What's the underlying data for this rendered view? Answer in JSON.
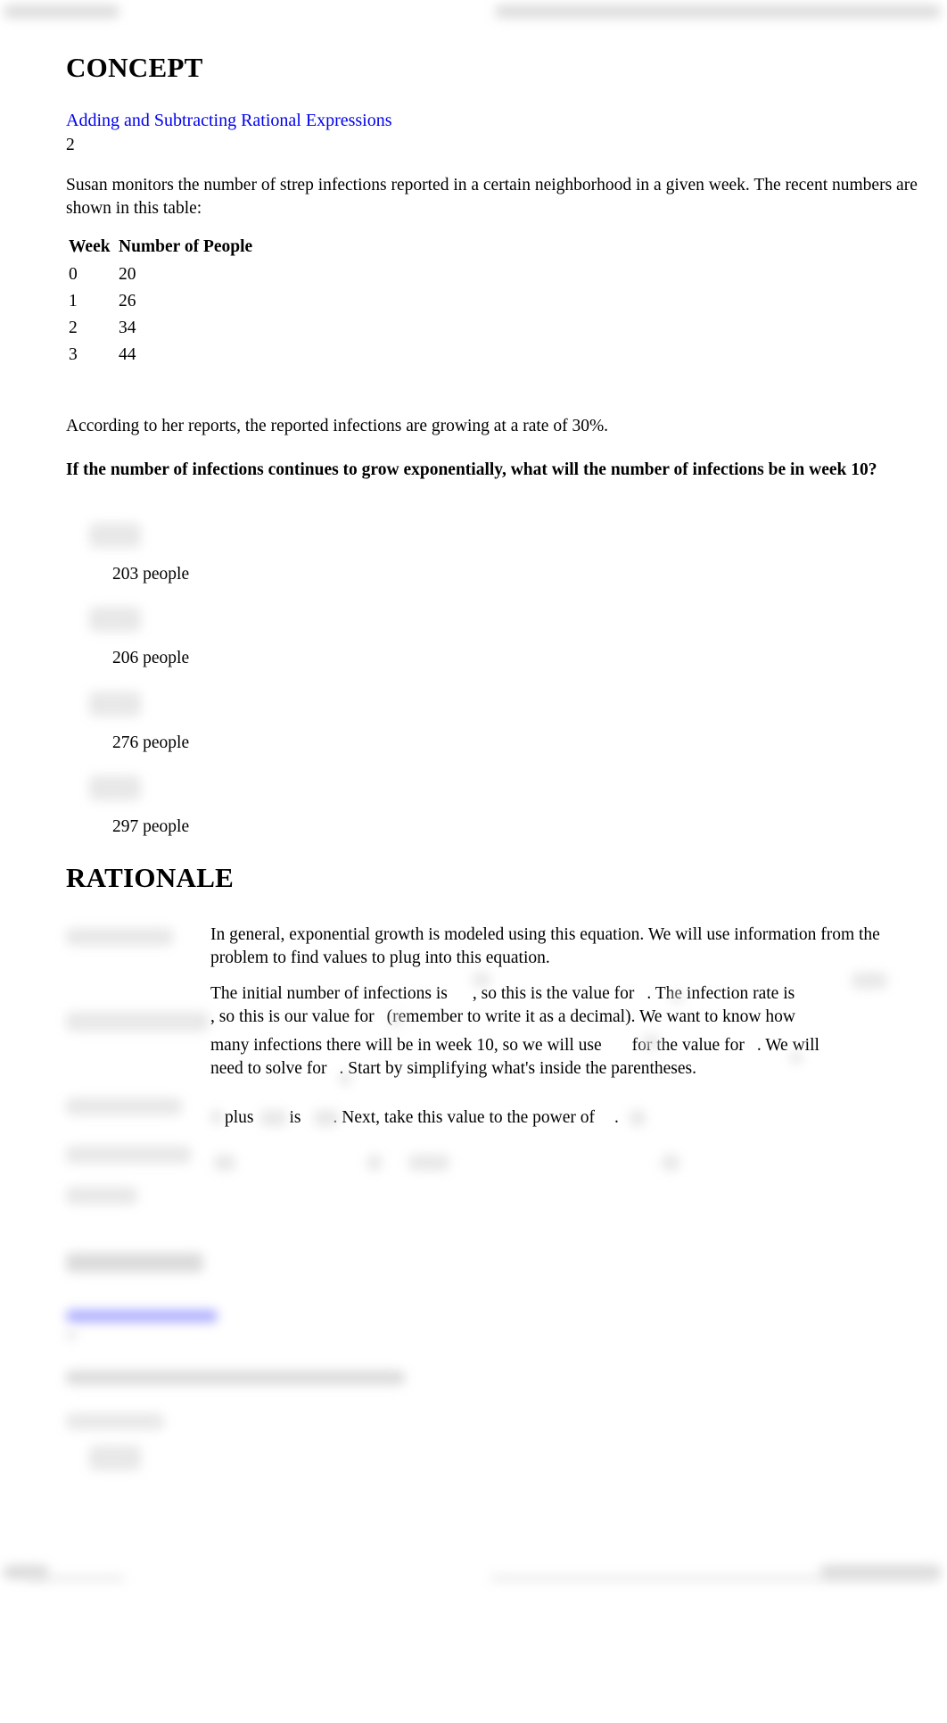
{
  "concept": {
    "heading": "CONCEPT",
    "link": "Adding and Subtracting Rational Expressions",
    "number": "2"
  },
  "problem": {
    "intro": "Susan monitors the number of strep infections reported in a certain neighborhood in a given week. The recent numbers are shown in this table:",
    "table": {
      "headers": [
        "Week",
        "Number of People"
      ],
      "rows": [
        [
          "0",
          "20"
        ],
        [
          "1",
          "26"
        ],
        [
          "2",
          "34"
        ],
        [
          "3",
          "44"
        ]
      ]
    },
    "rate_statement": "According to her reports, the reported infections are growing at a rate of 30%.",
    "question": "If the number of infections continues to grow exponentially, what will the number of infections be in week 10?",
    "options": [
      "203 people",
      "206 people",
      "276 people",
      "297 people"
    ]
  },
  "rationale": {
    "heading": "RATIONALE",
    "p1": "In general, exponential growth is modeled using this equation. We will use information from the problem to find values to plug into this equation.",
    "p2_parts": [
      "The initial number of infections is",
      ", so this is the value for",
      ". The infection rate is",
      ", so this is our value for",
      "(remember to write it as a decimal). We want to know how",
      "many infections there will be in week 10, so we will use",
      "for the value for",
      ". We will",
      "need to solve for",
      ". Start by simplifying what's inside the parentheses."
    ],
    "p3_parts": [
      "plus",
      "is",
      ". Next, take this value to the power of",
      "."
    ]
  }
}
